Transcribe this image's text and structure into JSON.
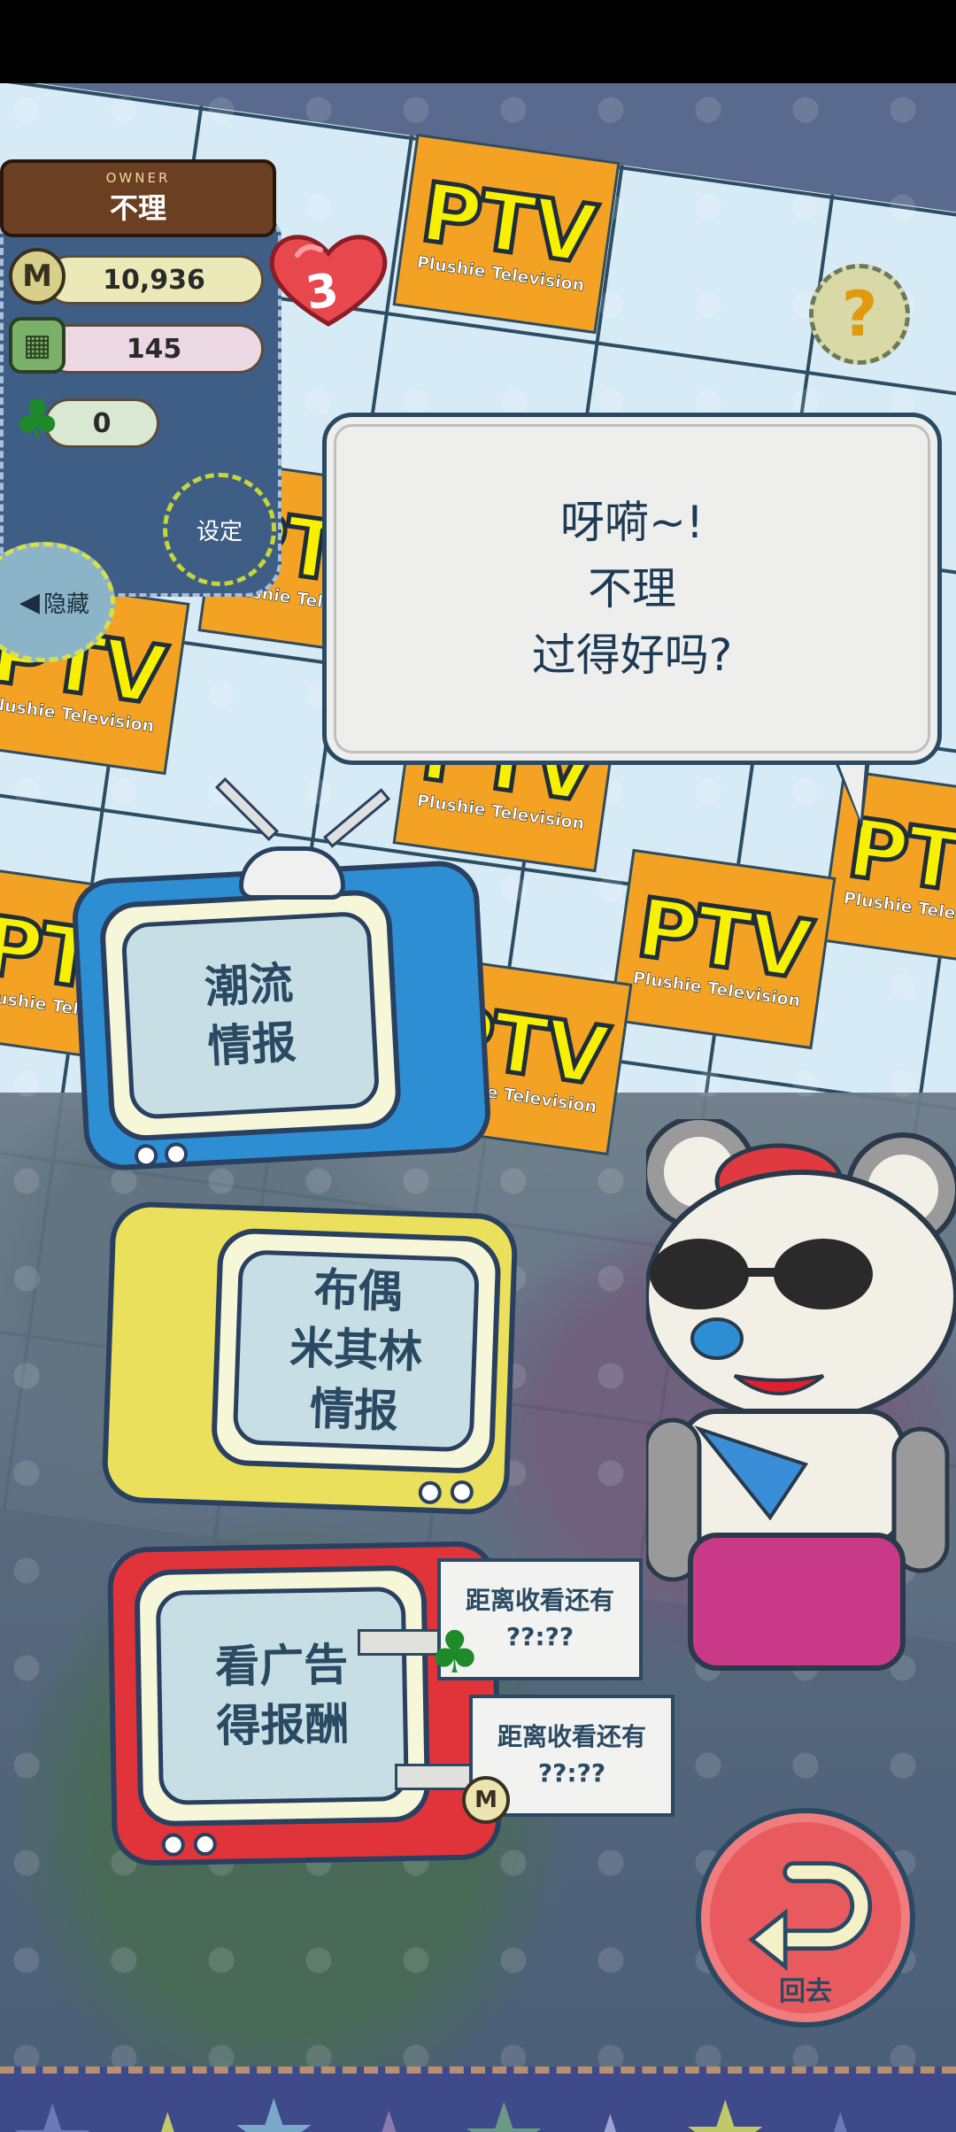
{
  "owner": {
    "label": "OWNER",
    "name": "不理"
  },
  "stats": {
    "coins": "10,936",
    "coin_icon": "M",
    "supplies": "145",
    "clovers": "0"
  },
  "hearts": {
    "count": "3"
  },
  "buttons": {
    "settings": "设定",
    "hide": "隐藏",
    "help": "?",
    "back": "回去"
  },
  "greeting": {
    "line1": "呀嗬~!",
    "line2": "不理",
    "line3": "过得好吗?"
  },
  "ptv": {
    "logo": "PTV",
    "subtitle": "Plushie Television"
  },
  "tvs": {
    "trends": [
      "潮流",
      "情报"
    ],
    "michelin": [
      "布偶",
      "米其林",
      "情报"
    ],
    "ads": [
      "看广告",
      "得报酬"
    ]
  },
  "timers": {
    "clover_label": "距离收看还有",
    "clover_time": "??:??",
    "coin_label": "距离收看还有",
    "coin_time": "??:??"
  },
  "colors": {
    "tile_orange": "#f4a223",
    "logo_yellow": "#f7f000",
    "tv_blue": "#2e8ed4",
    "tv_yellow": "#eae05c",
    "tv_red": "#e0343a",
    "back_red": "#e85a5e"
  }
}
